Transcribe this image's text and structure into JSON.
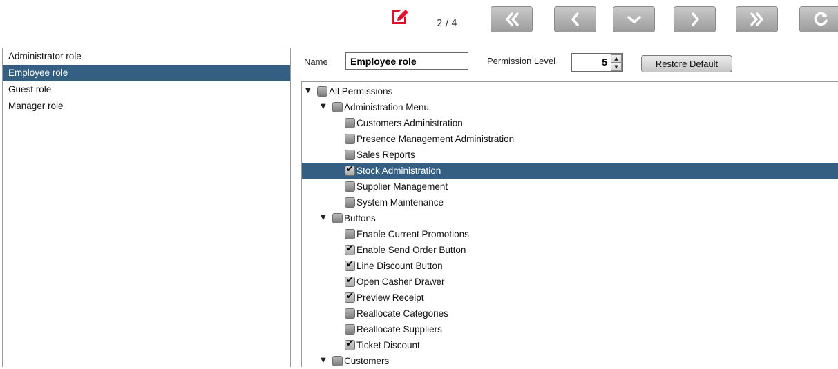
{
  "toolbar": {
    "page_counter": "2 / 4",
    "edit_color": "#e0102c",
    "buttons": [
      "first-icon",
      "previous-icon",
      "chevron-down-icon",
      "next-icon",
      "last-icon",
      "reload-icon"
    ]
  },
  "roles": [
    {
      "label": "Administrator role",
      "selected": false
    },
    {
      "label": "Employee role",
      "selected": true
    },
    {
      "label": "Guest role",
      "selected": false
    },
    {
      "label": "Manager role",
      "selected": false
    }
  ],
  "form": {
    "name_label": "Name",
    "name_value": "Employee role",
    "level_label": "Permission Level",
    "level_value": "5",
    "restore_label": "Restore Default"
  },
  "tree": [
    {
      "label": "All Permissions",
      "level": 0,
      "expandable": true,
      "checked": false,
      "selected": false
    },
    {
      "label": "Administration Menu",
      "level": 1,
      "expandable": true,
      "checked": false,
      "selected": false
    },
    {
      "label": "Customers Administration",
      "level": 2,
      "expandable": false,
      "checked": false,
      "selected": false
    },
    {
      "label": "Presence Management Administration",
      "level": 2,
      "expandable": false,
      "checked": false,
      "selected": false
    },
    {
      "label": "Sales Reports",
      "level": 2,
      "expandable": false,
      "checked": false,
      "selected": false
    },
    {
      "label": "Stock Administration",
      "level": 2,
      "expandable": false,
      "checked": true,
      "selected": true
    },
    {
      "label": "Supplier Management",
      "level": 2,
      "expandable": false,
      "checked": false,
      "selected": false
    },
    {
      "label": "System Maintenance",
      "level": 2,
      "expandable": false,
      "checked": false,
      "selected": false
    },
    {
      "label": "Buttons",
      "level": 1,
      "expandable": true,
      "checked": false,
      "selected": false
    },
    {
      "label": "Enable Current Promotions",
      "level": 2,
      "expandable": false,
      "checked": false,
      "selected": false
    },
    {
      "label": "Enable Send Order Button",
      "level": 2,
      "expandable": false,
      "checked": true,
      "selected": false
    },
    {
      "label": "Line Discount Button",
      "level": 2,
      "expandable": false,
      "checked": true,
      "selected": false
    },
    {
      "label": "Open Casher Drawer",
      "level": 2,
      "expandable": false,
      "checked": true,
      "selected": false
    },
    {
      "label": "Preview Receipt",
      "level": 2,
      "expandable": false,
      "checked": true,
      "selected": false
    },
    {
      "label": "Reallocate Categories",
      "level": 2,
      "expandable": false,
      "checked": false,
      "selected": false
    },
    {
      "label": "Reallocate Suppliers",
      "level": 2,
      "expandable": false,
      "checked": false,
      "selected": false
    },
    {
      "label": "Ticket Discount",
      "level": 2,
      "expandable": false,
      "checked": true,
      "selected": false
    },
    {
      "label": "Customers",
      "level": 1,
      "expandable": true,
      "checked": false,
      "selected": false
    }
  ]
}
